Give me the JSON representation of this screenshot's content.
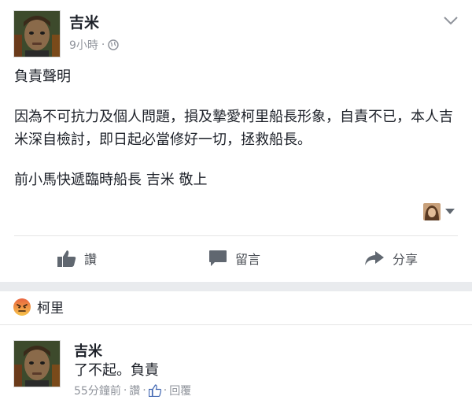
{
  "post": {
    "author": "吉米",
    "time": "9小時",
    "dot": "·",
    "body_lines": [
      "負責聲明",
      "因為不可抗力及個人問題，損及摯愛柯里船長形象，自責不已，本人吉米深自檢討，即日起必當修好一切，拯救船長。",
      "前小馬快遞臨時船長 吉米 敬上"
    ]
  },
  "actions": {
    "like": "讚",
    "comment": "留言",
    "share": "分享"
  },
  "reaction": {
    "name": "柯里"
  },
  "comment": {
    "author": "吉米",
    "text": "了不起。負責",
    "time": "55分鐘前",
    "sep": "·",
    "like": "讚",
    "reply": "回覆"
  },
  "icons": {
    "globe": "globe-icon",
    "chevron": "chevron-down-icon",
    "like": "thumbs-up-icon",
    "comment": "comment-bubble-icon",
    "share": "share-arrow-icon",
    "angry": "angry-reaction-icon"
  },
  "colors": {
    "text": "#1d2129",
    "meta": "#90949c",
    "action": "#4b4f56",
    "fb_blue": "#4267b2",
    "angry_orange": "#f0a13a"
  }
}
